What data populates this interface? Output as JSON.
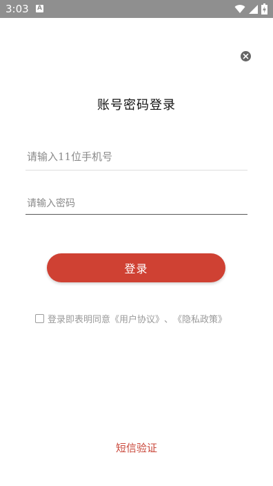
{
  "status_bar": {
    "time": "3:03",
    "notification_badge": "A",
    "icons": [
      "wifi-icon",
      "cellular-signal-icon",
      "battery-charging-icon"
    ]
  },
  "login": {
    "title": "账号密码登录",
    "phone_placeholder": "请输入11位手机号",
    "password_placeholder": "请输入密码",
    "login_button": "登录",
    "agreement_prefix": "登录即表明同意",
    "user_agreement": "《用户协议》",
    "separator": "、",
    "privacy_policy": "《隐私政策》",
    "sms_login_link": "短信验证"
  },
  "colors": {
    "accent": "#cf4133",
    "link": "#c9473a",
    "status_bar": "#8f8f8f"
  }
}
